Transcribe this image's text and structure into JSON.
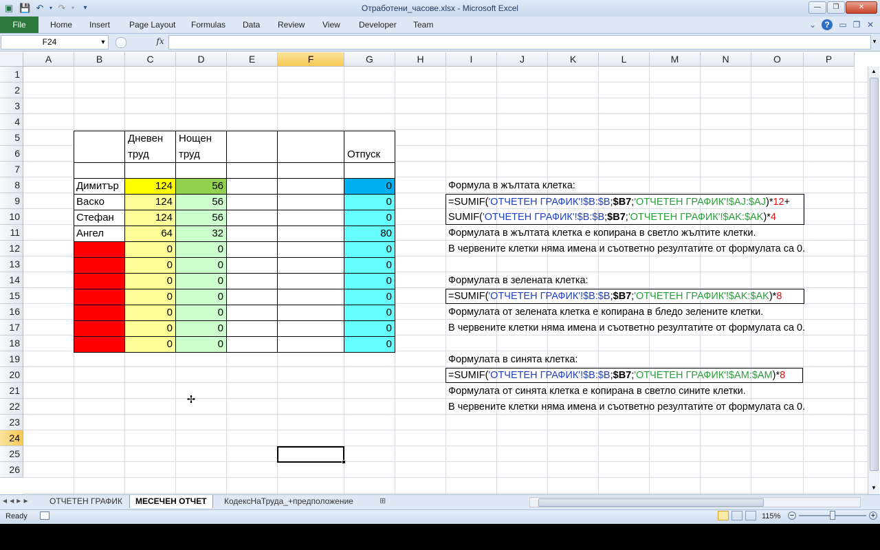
{
  "window": {
    "title": "Отработени_часове.xlsx - Microsoft Excel"
  },
  "ribbon": {
    "file": "File",
    "tabs": [
      "Home",
      "Insert",
      "Page Layout",
      "Formulas",
      "Data",
      "Review",
      "View",
      "Developer",
      "Team"
    ]
  },
  "formula_bar": {
    "name_box": "F24",
    "fx": "fx",
    "value": ""
  },
  "columns": [
    "A",
    "B",
    "C",
    "D",
    "E",
    "F",
    "G",
    "H",
    "I",
    "J",
    "K",
    "L",
    "M",
    "N",
    "O",
    "P"
  ],
  "selected_column": "F",
  "selected_row": "24",
  "rows": [
    "1",
    "2",
    "3",
    "4",
    "5",
    "6",
    "7",
    "8",
    "9",
    "10",
    "11",
    "12",
    "13",
    "14",
    "15",
    "16",
    "17",
    "18",
    "19",
    "20",
    "21",
    "22",
    "23",
    "24",
    "25",
    "26"
  ],
  "table": {
    "headers": {
      "day": "Дневен труд",
      "day_l1": "Дневен",
      "day_l2": "труд",
      "night_l1": "Нощен",
      "night_l2": "труд",
      "leave": "Отпуск"
    },
    "rows": [
      {
        "name": "Димитър",
        "day": "124",
        "night": "56",
        "leave": "0"
      },
      {
        "name": "Васко",
        "day": "124",
        "night": "56",
        "leave": "0"
      },
      {
        "name": "Стефан",
        "day": "124",
        "night": "56",
        "leave": "0"
      },
      {
        "name": "Ангел",
        "day": "64",
        "night": "32",
        "leave": "80"
      },
      {
        "name": "",
        "day": "0",
        "night": "0",
        "leave": "0"
      },
      {
        "name": "",
        "day": "0",
        "night": "0",
        "leave": "0"
      },
      {
        "name": "",
        "day": "0",
        "night": "0",
        "leave": "0"
      },
      {
        "name": "",
        "day": "0",
        "night": "0",
        "leave": "0"
      },
      {
        "name": "",
        "day": "0",
        "night": "0",
        "leave": "0"
      },
      {
        "name": "",
        "day": "0",
        "night": "0",
        "leave": "0"
      },
      {
        "name": "",
        "day": "0",
        "night": "0",
        "leave": "0"
      }
    ]
  },
  "notes": {
    "yellow_title": "Формула в жълтата клетка:",
    "yellow_f1": {
      "a": "=SUMIF(",
      "b": "'ОТЧЕТЕН ГРАФИК'!$B:$B",
      "c": ";",
      "d": "$B7",
      "e": ";",
      "f": "'ОТЧЕТЕН ГРАФИК'!$AJ:$AJ",
      "g": ")*",
      "h": "12",
      "i": "+"
    },
    "yellow_f2": {
      "a": "SUMIF(",
      "b": "'ОТЧЕТЕН ГРАФИК'!$B:$B",
      "c": ";",
      "d": "$B7",
      "e": ";",
      "f": "'ОТЧЕТЕН ГРАФИК'!$AK:$AK",
      "g": ")*",
      "h": "4"
    },
    "yellow_copy": "Формулата в жълтата клетка е копирана в светло жълтите клетки.",
    "red_note_1": "В червените клетки няма имена и съответно резултатите от формулата са 0.",
    "green_title": "Формулата в зелената клетка:",
    "green_f": {
      "a": "=SUMIF(",
      "b": "'ОТЧЕТЕН ГРАФИК'!$B:$B",
      "c": ";",
      "d": "$B7",
      "e": ";",
      "f": "'ОТЧЕТЕН ГРАФИК'!$AK:$AK",
      "g": ")*",
      "h": "8"
    },
    "green_copy": "Формулата от зелената клетка е копирана в бледо зелените клетки.",
    "red_note_2": "В червените клетки няма имена и съответно резултатите от формулата са 0.",
    "blue_title": "Формулата в синята клетка:",
    "blue_f": {
      "a": "=SUMIF(",
      "b": "'ОТЧЕТЕН ГРАФИК'!$B:$B",
      "c": ";",
      "d": "$B7",
      "e": ";",
      "f": "'ОТЧЕТЕН ГРАФИК'!$AM:$AM",
      "g": ")*",
      "h": "8"
    },
    "blue_copy": "Формулата от синята клетка е копирана в светло сините клетки.",
    "red_note_3": "В червените клетки няма имена и съответно резултатите от формулата са 0."
  },
  "sheets": [
    "ОТЧЕТЕН ГРАФИК",
    "МЕСЕЧЕН ОТЧЕТ",
    "КодексНаТруда_+предположение"
  ],
  "active_sheet": "МЕСЕЧЕН ОТЧЕТ",
  "status": {
    "ready": "Ready",
    "zoom": "115%"
  },
  "colors": {
    "yellow": "#ffff00",
    "light_yellow": "#ffff99",
    "green": "#92d050",
    "light_green": "#ccffcc",
    "blue": "#00b0f0",
    "light_blue": "#66ffff",
    "red": "#ff0000",
    "file_tab": "#2d7a3d"
  },
  "icons": [
    "save-icon",
    "undo-icon",
    "redo-icon",
    "customize-icon",
    "minimize-icon",
    "restore-icon",
    "close-icon",
    "help-icon",
    "chevron-down-icon",
    "mouse-cursor-icon",
    "macro-record-icon",
    "new-sheet-icon"
  ]
}
